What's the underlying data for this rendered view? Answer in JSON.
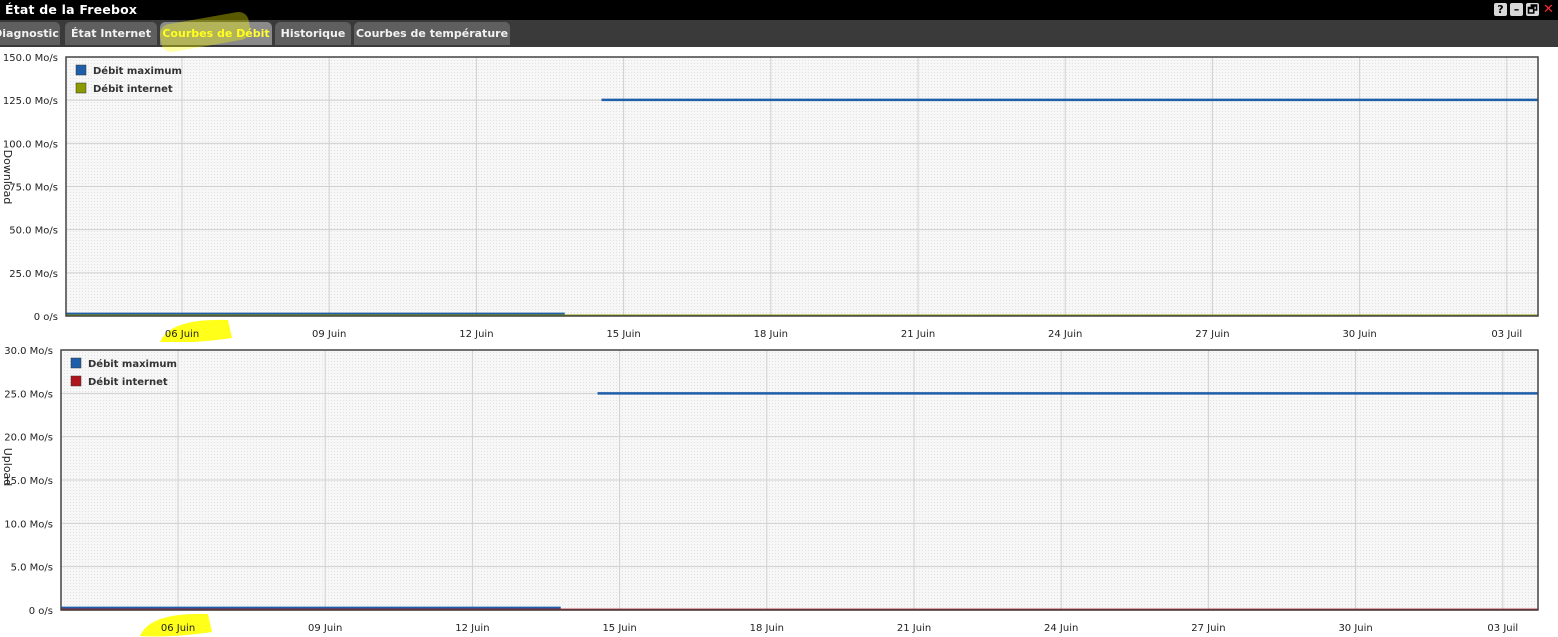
{
  "app": {
    "title": "État de la Freebox",
    "buttons": {
      "help": "?",
      "minimize": "–",
      "maximize": "🗗",
      "close": "✕"
    }
  },
  "tabs": [
    {
      "label": "Diagnostic",
      "active": false
    },
    {
      "label": "État Internet",
      "active": false
    },
    {
      "label": "Courbes de Débit",
      "active": true
    },
    {
      "label": "Historique",
      "active": false
    },
    {
      "label": "Courbes de température",
      "active": false
    }
  ],
  "colors": {
    "max_series": "#1f5ea8",
    "download_series": "#8a9a00",
    "upload_series": "#b0141c",
    "highlight": "#ffff00"
  },
  "chart_data": [
    {
      "type": "line",
      "ylabel": "Download",
      "y_ticks": [
        "150.0 Mo/s",
        "125.0 Mo/s",
        "100.0 Mo/s",
        "75.0 Mo/s",
        "50.0 Mo/s",
        "25.0 Mo/s",
        "0 o/s"
      ],
      "ylim": [
        0,
        150
      ],
      "x_ticks": [
        "06 Juin",
        "09 Juin",
        "12 Juin",
        "15 Juin",
        "18 Juin",
        "21 Juin",
        "24 Juin",
        "27 Juin",
        "30 Juin",
        "03 Juil"
      ],
      "grid": true,
      "legend_position": "top-left",
      "series": [
        {
          "name": "Débit maximum",
          "color": "#1f5ea8",
          "segments": [
            {
              "x": [
                0,
                2.6
              ],
              "y": [
                1.2,
                1.2
              ]
            },
            {
              "x": [
                2.85,
                10.4
              ],
              "y": [
                125.2,
                125.2
              ]
            }
          ]
        },
        {
          "name": "Débit internet",
          "color": "#8a9a00",
          "segments": [
            {
              "x": [
                0,
                10.4
              ],
              "y": [
                0.3,
                0.3
              ]
            }
          ]
        }
      ]
    },
    {
      "type": "line",
      "ylabel": "Upload",
      "y_ticks": [
        "30.0 Mo/s",
        "25.0 Mo/s",
        "20.0 Mo/s",
        "15.0 Mo/s",
        "10.0 Mo/s",
        "5.0 Mo/s",
        "0 o/s"
      ],
      "ylim": [
        0,
        30
      ],
      "x_ticks": [
        "06 Juin",
        "09 Juin",
        "12 Juin",
        "15 Juin",
        "18 Juin",
        "21 Juin",
        "24 Juin",
        "27 Juin",
        "30 Juin",
        "03 Juil"
      ],
      "grid": true,
      "legend_position": "top-left",
      "series": [
        {
          "name": "Débit maximum",
          "color": "#1f5ea8",
          "segments": [
            {
              "x": [
                0,
                2.6
              ],
              "y": [
                0.25,
                0.25
              ]
            },
            {
              "x": [
                2.85,
                10.4
              ],
              "y": [
                25.0,
                25.0
              ]
            }
          ]
        },
        {
          "name": "Débit internet",
          "color": "#b0141c",
          "segments": [
            {
              "x": [
                0,
                10.4
              ],
              "y": [
                0.05,
                0.05
              ]
            }
          ]
        }
      ]
    }
  ]
}
